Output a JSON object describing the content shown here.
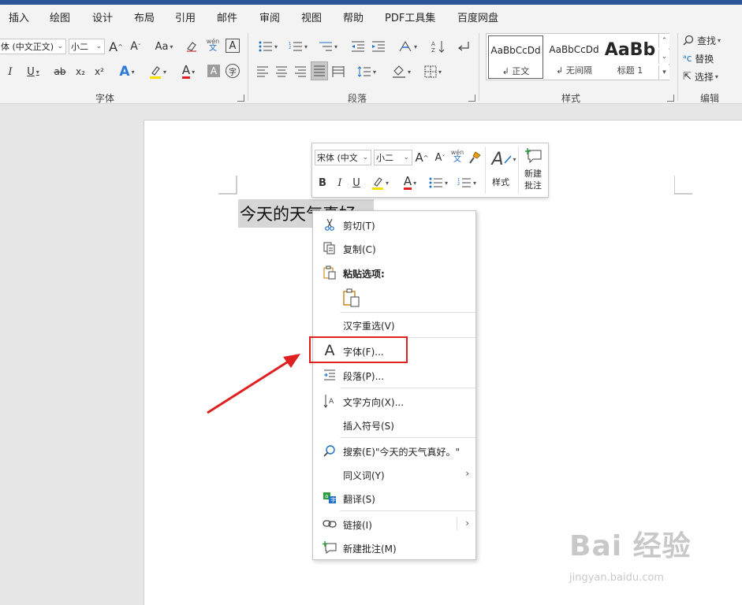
{
  "ribbon": {
    "tabs": [
      "插入",
      "绘图",
      "设计",
      "布局",
      "引用",
      "邮件",
      "审阅",
      "视图",
      "帮助",
      "PDF工具集",
      "百度网盘"
    ],
    "font_name": "体 (中文正文)",
    "font_size": "小二",
    "groups": {
      "font": "字体",
      "paragraph": "段落",
      "styles": "样式",
      "editing": "编辑"
    },
    "styles": [
      {
        "preview": "AaBbCcDd",
        "name": "↲ 正文"
      },
      {
        "preview": "AaBbCcDd",
        "name": "↲ 无间隔"
      },
      {
        "preview": "AaBb",
        "name": "标题 1"
      }
    ],
    "editing": {
      "find": "查找",
      "replace": "替换",
      "select": "选择"
    },
    "labels": {
      "grow": "A",
      "shrink": "A",
      "case": "Aa",
      "wen": "wén",
      "wen_char": "文",
      "char_border": "A",
      "italic": "I",
      "underline": "U",
      "strike": "ab",
      "subscript": "x₂",
      "superscript": "x²",
      "text_effect": "A",
      "font_color": "A",
      "char_shade": "A",
      "enclosed": "字"
    }
  },
  "document": {
    "text": "今天的天气真好。"
  },
  "mini_toolbar": {
    "font_name": "宋体 (中文",
    "font_size": "小二",
    "styles_label": "样式",
    "new_comment_label": "新建批注",
    "bold": "B",
    "italic": "I",
    "underline": "U",
    "grow": "A",
    "shrink": "A",
    "wen": "wén",
    "wen_char": "文",
    "highlight": "A",
    "font_color": "A",
    "styles_icon": "A"
  },
  "context_menu": {
    "items": [
      {
        "label": "剪切(T)",
        "icon": "scissors-icon"
      },
      {
        "label": "复制(C)",
        "icon": "copy-icon"
      },
      {
        "label": "粘贴选项:",
        "icon": "paste-icon"
      },
      {
        "label": "汉字重选(V)",
        "icon": ""
      },
      {
        "label": "字体(F)...",
        "icon": "font-icon"
      },
      {
        "label": "段落(P)...",
        "icon": "paragraph-icon"
      },
      {
        "label": "文字方向(X)...",
        "icon": "text-direction-icon"
      },
      {
        "label": "插入符号(S)",
        "icon": ""
      },
      {
        "label": "搜索(E)\"今天的天气真好。\"",
        "icon": "search-icon"
      },
      {
        "label": "同义词(Y)",
        "icon": ""
      },
      {
        "label": "翻译(S)",
        "icon": "translate-icon"
      },
      {
        "label": "链接(I)",
        "icon": "link-icon"
      },
      {
        "label": "新建批注(M)",
        "icon": "new-comment-icon"
      }
    ],
    "font_glyph": "A",
    "submenu_arrow": "›"
  },
  "watermark": {
    "main": "Bai 经验",
    "sub": "jingyan.baidu.com"
  },
  "colors": {
    "accent": "#2b579a",
    "highlight_box": "#e02020",
    "font_red": "#e02020",
    "highlight_yellow": "#f5e000"
  }
}
